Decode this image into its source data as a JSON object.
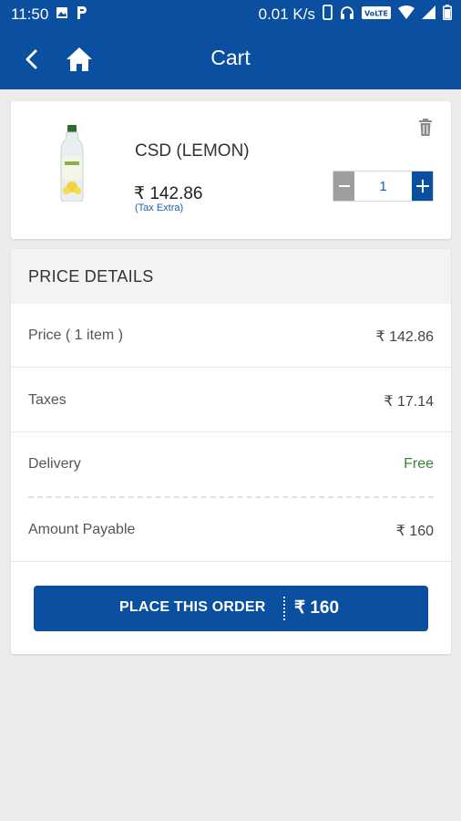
{
  "status_bar": {
    "time": "11:50",
    "network_speed": "0.01 K/s",
    "volte": "VoLTE",
    "icons": [
      "image-icon",
      "p-icon",
      "phone-icon",
      "headset-icon",
      "volte-icon",
      "wifi-icon",
      "signal-icon",
      "battery-icon"
    ]
  },
  "app_bar": {
    "title": "Cart",
    "back_icon": "back-arrow-icon",
    "home_icon": "home-icon",
    "color": "#0b4fa1"
  },
  "cart_item": {
    "name": "CSD (LEMON)",
    "price": "₹ 142.86",
    "tax_note": "(Tax Extra)",
    "quantity": "1",
    "minus_label": "−",
    "plus_label": "+"
  },
  "price_details": {
    "header": "PRICE DETAILS",
    "rows": [
      {
        "label": "Price ( 1 item )",
        "value": "₹ 142.86"
      },
      {
        "label": "Taxes",
        "value": "₹ 17.14"
      },
      {
        "label": "Delivery",
        "value": "Free"
      },
      {
        "label": "Amount Payable",
        "value": "₹ 160"
      }
    ]
  },
  "order_button": {
    "label": "PLACE THIS ORDER",
    "amount": "₹ 160"
  },
  "colors": {
    "primary": "#0b4fa1",
    "free": "#2e8b2e",
    "background": "#ececec"
  }
}
